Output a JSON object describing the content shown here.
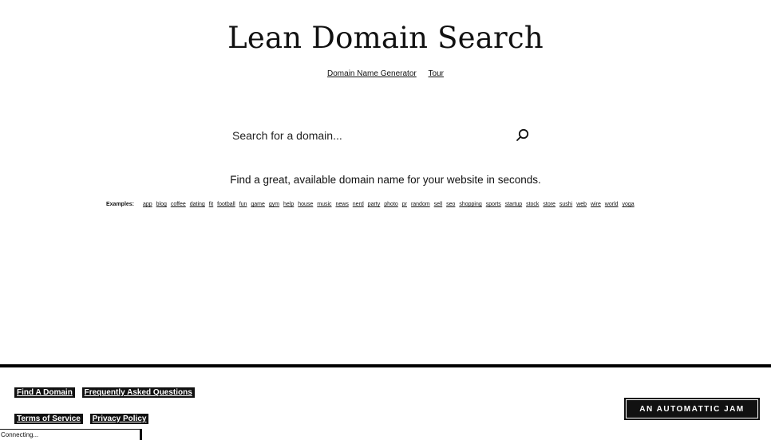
{
  "header": {
    "title": "Lean Domain Search",
    "nav": [
      {
        "label": "Domain Name Generator"
      },
      {
        "label": "Tour"
      }
    ]
  },
  "search": {
    "placeholder": "Search for a domain...",
    "button_icon": "search-icon"
  },
  "tagline": "Find a great, available domain name for your website in seconds.",
  "examples": {
    "label": "Examples:",
    "items": [
      "app",
      "blog",
      "coffee",
      "dating",
      "fit",
      "football",
      "fun",
      "game",
      "gym",
      "help",
      "house",
      "music",
      "news",
      "nerd",
      "party",
      "photo",
      "pr",
      "random",
      "sell",
      "seo",
      "shopping",
      "sports",
      "startup",
      "stock",
      "store",
      "sushi",
      "web",
      "wire",
      "world",
      "yoga"
    ]
  },
  "footer": {
    "links_row1": [
      "Find A Domain",
      "Frequently Asked Questions"
    ],
    "links_row2": [
      "Terms of Service",
      "Privacy Policy"
    ],
    "badge": "AN AUTOMATTIC JAM"
  },
  "status": "Connecting..."
}
